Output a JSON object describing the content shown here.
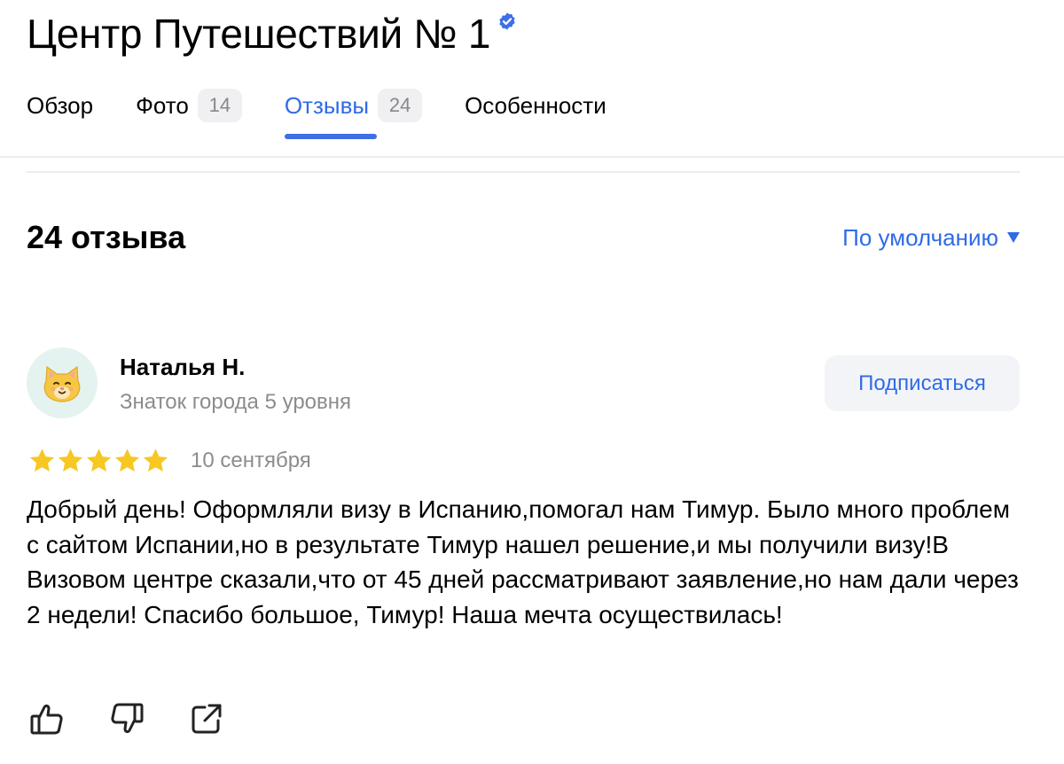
{
  "header": {
    "title": "Центр Путешествий № 1",
    "verified_icon": "verified-check-icon",
    "accent_color": "#2f6be8"
  },
  "tabs": [
    {
      "label": "Обзор",
      "count": null,
      "active": false
    },
    {
      "label": "Фото",
      "count": "14",
      "active": false
    },
    {
      "label": "Отзывы",
      "count": "24",
      "active": true
    },
    {
      "label": "Особенности",
      "count": null,
      "active": false
    }
  ],
  "reviews": {
    "count_label": "24 отзыва",
    "sort_label": "По умолчанию"
  },
  "review": {
    "author_name": "Наталья Н.",
    "author_level": "Знаток города 5 уровня",
    "avatar_icon": "cat-face-icon",
    "subscribe_label": "Подписаться",
    "rating": 5,
    "rating_max": 5,
    "star_color": "#f7c722",
    "date": "10 сентября",
    "text": "Добрый день! Оформляли визу в Испанию,помогал нам Тимур. Было много проблем с сайтом Испании,но в результате Тимур нашел решение,и мы получили визу!В Визовом центре сказали,что от 45 дней рассматривают заявление,но нам дали через 2 недели! Спасибо большое, Тимур! Наша мечта осуществилась!",
    "actions": [
      "thumbs-up-icon",
      "thumbs-down-icon",
      "share-icon"
    ]
  }
}
